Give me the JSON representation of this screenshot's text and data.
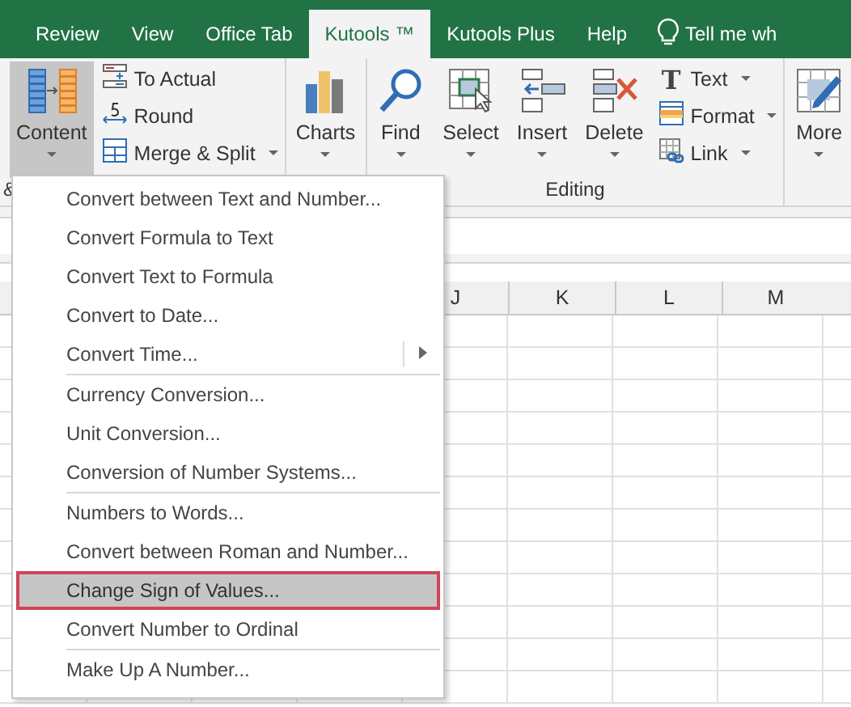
{
  "tabs": [
    {
      "label": "Review",
      "selected": false
    },
    {
      "label": "View",
      "selected": false
    },
    {
      "label": "Office Tab",
      "selected": false
    },
    {
      "label": "Kutools ™",
      "selected": true
    },
    {
      "label": "Kutools Plus",
      "selected": false
    },
    {
      "label": "Help",
      "selected": false
    }
  ],
  "tell_me": "Tell me wh",
  "ribbon": {
    "groups": [
      {
        "label": "&",
        "controls": [
          {
            "kind": "large",
            "label": "Content",
            "pressed": true,
            "dropdown": true
          },
          {
            "kind": "stack",
            "items": [
              {
                "label": "To Actual",
                "dropdown": false
              },
              {
                "label": "Round",
                "dropdown": false
              },
              {
                "label": "Merge & Split",
                "dropdown": true
              }
            ]
          }
        ]
      },
      {
        "controls": [
          {
            "kind": "large",
            "label": "Charts",
            "pressed": false,
            "dropdown": true
          }
        ]
      },
      {
        "label": "Editing",
        "controls": [
          {
            "kind": "large",
            "label": "Find",
            "pressed": false,
            "dropdown": true
          },
          {
            "kind": "large",
            "label": "Select",
            "pressed": false,
            "dropdown": true
          },
          {
            "kind": "large",
            "label": "Insert",
            "pressed": false,
            "dropdown": true
          },
          {
            "kind": "large",
            "label": "Delete",
            "pressed": false,
            "dropdown": true
          },
          {
            "kind": "stack",
            "items": [
              {
                "label": "Text",
                "glyph": "T",
                "dropdown": true
              },
              {
                "label": "Format",
                "dropdown": true
              },
              {
                "label": "Link",
                "dropdown": true
              }
            ]
          }
        ]
      },
      {
        "controls": [
          {
            "kind": "large",
            "label": "More",
            "pressed": false,
            "dropdown": true
          }
        ]
      }
    ]
  },
  "columns": [
    "J",
    "K",
    "L",
    "M"
  ],
  "menu": {
    "sections": [
      [
        {
          "label": "Convert between Text and Number...",
          "selected": false,
          "submenu": false
        },
        {
          "label": "Convert Formula to Text",
          "selected": false,
          "submenu": false
        },
        {
          "label": "Convert Text to Formula",
          "selected": false,
          "submenu": false
        },
        {
          "label": "Convert to Date...",
          "selected": false,
          "submenu": false
        },
        {
          "label": "Convert Time...",
          "selected": false,
          "submenu": true
        }
      ],
      [
        {
          "label": "Currency Conversion...",
          "selected": false,
          "submenu": false
        },
        {
          "label": "Unit Conversion...",
          "selected": false,
          "submenu": false
        },
        {
          "label": "Conversion of Number Systems...",
          "selected": false,
          "submenu": false
        }
      ],
      [
        {
          "label": "Numbers to Words...",
          "selected": false,
          "submenu": false
        },
        {
          "label": "Convert between Roman and Number...",
          "selected": false,
          "submenu": false
        },
        {
          "label": "Change Sign of Values...",
          "selected": true,
          "submenu": false
        },
        {
          "label": "Convert Number to Ordinal",
          "selected": false,
          "submenu": false
        }
      ],
      [
        {
          "label": "Make Up A Number...",
          "selected": false,
          "submenu": false
        }
      ]
    ]
  }
}
